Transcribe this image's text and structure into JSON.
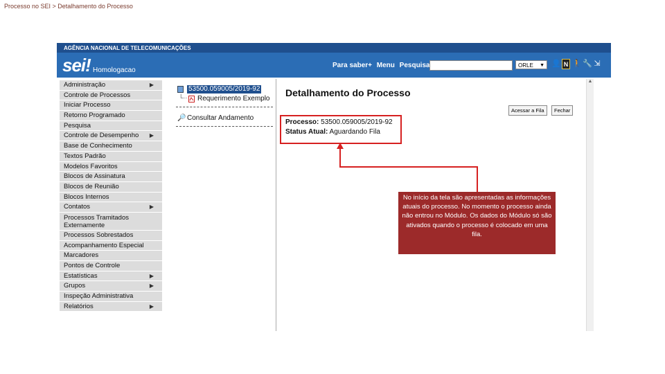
{
  "breadcrumb": "Processo no SEI > Detalhamento do Processo",
  "header": {
    "agency": "AGÊNCIA NACIONAL DE TELECOMUNICAÇÕES",
    "logo": "sei!",
    "environment": "Homologacao",
    "links": [
      "Para saber+",
      "Menu",
      "Pesquisa"
    ],
    "unit_selected": "ORLE"
  },
  "icons": [
    "user-icon",
    "notification-n-icon",
    "person-icon",
    "tools-icon",
    "exit-icon"
  ],
  "menu": [
    {
      "label": "Administração",
      "has_sub": true
    },
    {
      "label": "Controle de Processos",
      "has_sub": false
    },
    {
      "label": "Iniciar Processo",
      "has_sub": false
    },
    {
      "label": "Retorno Programado",
      "has_sub": false
    },
    {
      "label": "Pesquisa",
      "has_sub": false
    },
    {
      "label": "Controle de Desempenho",
      "has_sub": true
    },
    {
      "label": "Base de Conhecimento",
      "has_sub": false
    },
    {
      "label": "Textos Padrão",
      "has_sub": false
    },
    {
      "label": "Modelos Favoritos",
      "has_sub": false
    },
    {
      "label": "Blocos de Assinatura",
      "has_sub": false
    },
    {
      "label": "Blocos de Reunião",
      "has_sub": false
    },
    {
      "label": "Blocos Internos",
      "has_sub": false
    },
    {
      "label": "Contatos",
      "has_sub": true
    },
    {
      "label": "Processos Tramitados Externamente",
      "has_sub": false
    },
    {
      "label": "Processos Sobrestados",
      "has_sub": false
    },
    {
      "label": "Acompanhamento Especial",
      "has_sub": false
    },
    {
      "label": "Marcadores",
      "has_sub": false
    },
    {
      "label": "Pontos de Controle",
      "has_sub": false
    },
    {
      "label": "Estatísticas",
      "has_sub": true
    },
    {
      "label": "Grupos",
      "has_sub": true
    },
    {
      "label": "Inspeção Administrativa",
      "has_sub": false
    },
    {
      "label": "Relatórios",
      "has_sub": true
    }
  ],
  "tree": {
    "process_number": "53500.059005/2019-92",
    "document": "Requerimento Exemplo",
    "consult": "Consultar Andamento"
  },
  "main": {
    "title": "Detalhamento do Processo",
    "buttons": [
      "Acessar a Fila",
      "Fechar"
    ],
    "process_label": "Processo:",
    "process_value": "53500.059005/2019-92",
    "status_label": "Status Atual:",
    "status_value": "Aguardando Fila"
  },
  "callout": "No início da tela são apresentadas as informações atuais do processo. No momento o processo ainda não entrou no Módulo. Os dados do Módulo só são ativados quando o processo é colocado em uma fila.",
  "colors": {
    "header": "#2b6db5",
    "agency_bar": "#1f4f8e",
    "highlight": "#d62020",
    "callout": "#9c2a2a"
  }
}
